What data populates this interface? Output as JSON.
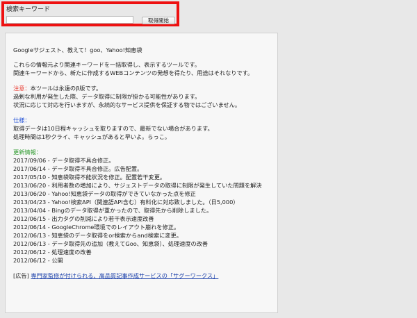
{
  "search": {
    "label": "検索キーワード",
    "value": "",
    "button_label": "取得開始"
  },
  "panel": {
    "heading": "Googleサジェスト、教えて！goo、Yahoo!知恵袋",
    "intro_lines": [
      "これらの情報元より関連キーワードを一括取得し、表示するツールです。",
      "関連キーワードから、新たに作成するWEBコンテンツの発想を得たり、用途はそれなりです。"
    ],
    "notice": {
      "label": "注意：",
      "first_line_rest": "本ツールは永遠のβ版です。",
      "lines": [
        "過剰な利用が発生した際、データ取得に制限が掛かる可能性があります。",
        "状況に応じて対応を行いますが、永続的なサービス提供を保証する物ではございません。"
      ]
    },
    "spec": {
      "label": "仕様：",
      "lines": [
        "取得データは10日程キャッシュを取りますので、最新でない場合があります。",
        "処理時間は1秒クライ、キャッシュがあると早いよ。らっこ。"
      ]
    },
    "updates": {
      "label": "更新情報：",
      "items": [
        "2017/09/06 - データ取得不具合修正。",
        "2017/06/14 - データ取得不具合修正。広告配置。",
        "2017/05/10 - 知恵袋取得不能状況を修正。配置若干変更。",
        "2013/06/20 - 利用者数の増加により、サジェストデータの取得に制限が発生していた問題を解決",
        "2013/06/20 - Yahoo!知恵袋データの取得ができていなかった点を修正",
        "2013/04/23 - Yahoo!検索API（関連語API含む）有料化に対応致しました。（日5,000）",
        "2013/04/04 - Bingのデータ取得が重かったので、取得先から削除しました。",
        "2012/06/15 - 出力タグの削減により若干表示速度改善",
        "2012/06/14 - GoogleChrome環境でのレイアウト崩れを修正。",
        "2012/06/13 - 知恵袋のデータ取得をor検索からand検索に変更。",
        "2012/06/13 - データ取得先の追加（教えてGoo、知恵袋）、処理速度の改善",
        "2012/06/12 - 処理速度の改善",
        "2012/06/12 - 公開"
      ]
    },
    "ad": {
      "prefix": "[広告] ",
      "link_text": "専門家監修が付けられる、高品質記事作成サービスの「サグーワークス」"
    }
  }
}
